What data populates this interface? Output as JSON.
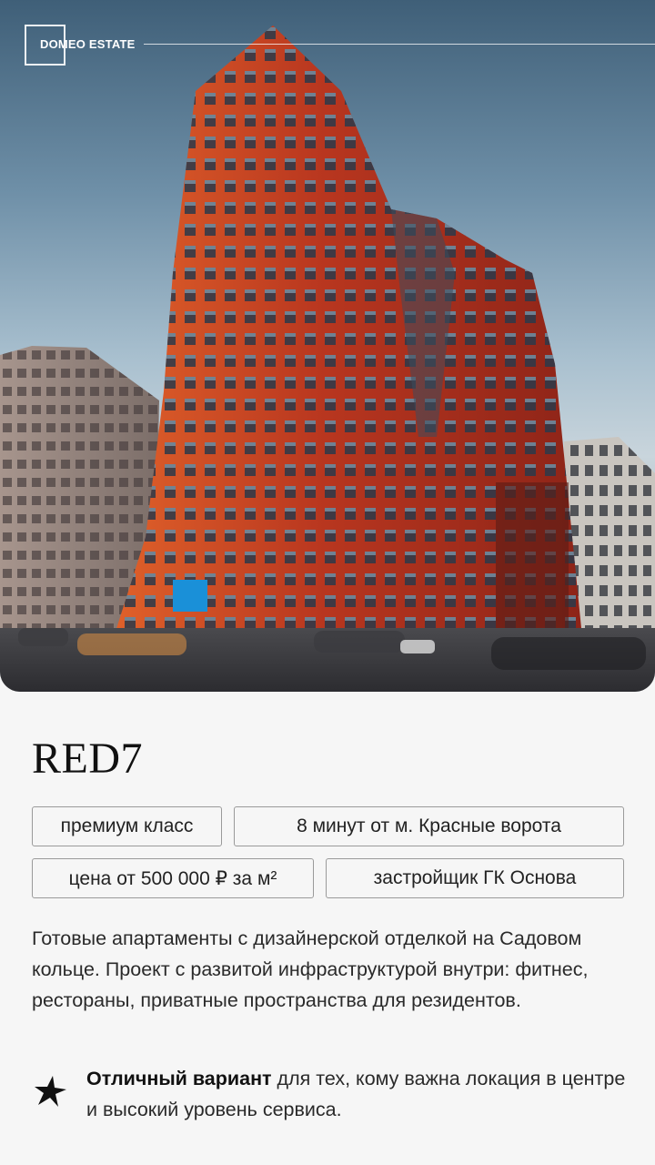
{
  "brand": {
    "logo_text": "DOMEO ESTATE"
  },
  "project": {
    "title": "RED7",
    "tags": [
      "премиум класс",
      "8 минут от м. Красные ворота",
      "цена от 500 000 ₽ за м²",
      "застройщик ГК Основа"
    ],
    "description": "Готовые апартаменты с дизайнерской отделкой на Садовом кольце. Проект с развитой инфраструктурой внутри: фитнес, рестораны, приватные пространства для резидентов.",
    "highlight": {
      "bold": "Отличный вариант",
      "rest": " для тех, кому важна локация в центре и высокий уровень сервиса."
    }
  },
  "icons": {
    "highlight": "sparkle-star-icon"
  },
  "colors": {
    "building": "#b5331f",
    "text": "#1a1a1a",
    "background": "#f6f6f6",
    "tag_border": "#9a9a9a"
  }
}
